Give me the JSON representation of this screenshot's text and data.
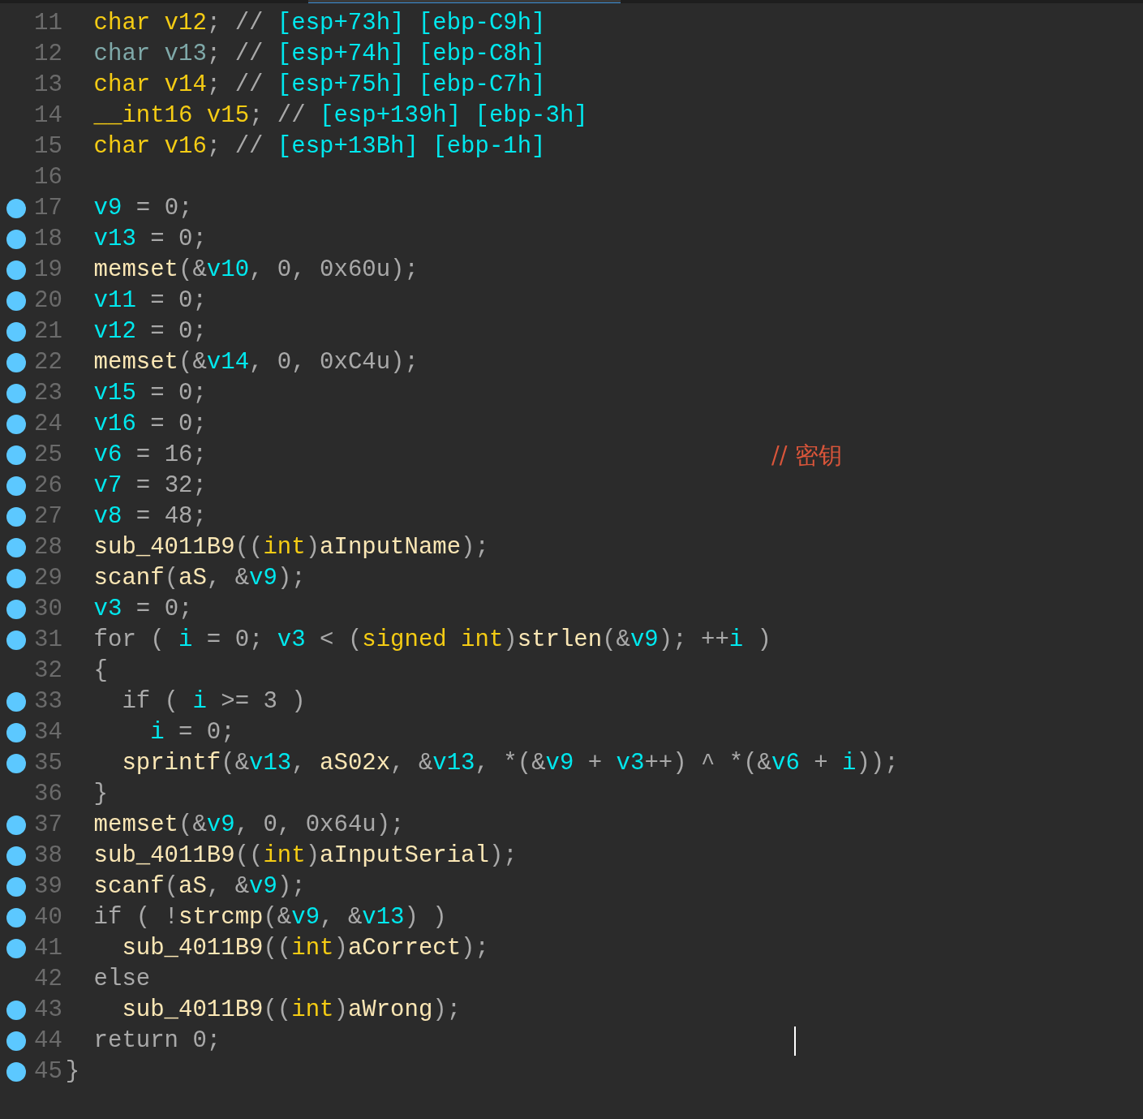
{
  "lines": [
    {
      "number": "11",
      "breakpoint": false,
      "tokens": [
        {
          "kind": "type",
          "text": "  char v12"
        },
        {
          "kind": "plain",
          "text": "; // "
        },
        {
          "kind": "address",
          "text": "[esp+73h] [ebp-C9h]"
        }
      ]
    },
    {
      "number": "12",
      "breakpoint": false,
      "tokens": [
        {
          "kind": "dim",
          "text": "  char v13"
        },
        {
          "kind": "plain",
          "text": "; // "
        },
        {
          "kind": "address",
          "text": "[esp+74h] [ebp-C8h]"
        }
      ]
    },
    {
      "number": "13",
      "breakpoint": false,
      "tokens": [
        {
          "kind": "type",
          "text": "  char v14"
        },
        {
          "kind": "plain",
          "text": "; // "
        },
        {
          "kind": "address",
          "text": "[esp+75h] [ebp-C7h]"
        }
      ]
    },
    {
      "number": "14",
      "breakpoint": false,
      "tokens": [
        {
          "kind": "type",
          "text": "  __int16 v15"
        },
        {
          "kind": "plain",
          "text": "; // "
        },
        {
          "kind": "address",
          "text": "[esp+139h] [ebp-3h]"
        }
      ]
    },
    {
      "number": "15",
      "breakpoint": false,
      "tokens": [
        {
          "kind": "type",
          "text": "  char v16"
        },
        {
          "kind": "plain",
          "text": "; // "
        },
        {
          "kind": "address",
          "text": "[esp+13Bh] [ebp-1h]"
        }
      ]
    },
    {
      "number": "16",
      "breakpoint": false
    },
    {
      "number": "17",
      "breakpoint": true,
      "tokens": [
        {
          "kind": "var",
          "text": "  v9"
        },
        {
          "kind": "plain",
          "text": " = 0;"
        }
      ]
    },
    {
      "number": "18",
      "breakpoint": true,
      "tokens": [
        {
          "kind": "var",
          "text": "  v13"
        },
        {
          "kind": "plain",
          "text": " = 0;"
        }
      ]
    },
    {
      "number": "19",
      "breakpoint": true,
      "tokens": [
        {
          "kind": "func",
          "text": "  memset"
        },
        {
          "kind": "plain",
          "text": "(&"
        },
        {
          "kind": "var",
          "text": "v10"
        },
        {
          "kind": "plain",
          "text": ", 0, 0x60u);"
        }
      ]
    },
    {
      "number": "20",
      "breakpoint": true,
      "tokens": [
        {
          "kind": "var",
          "text": "  v11"
        },
        {
          "kind": "plain",
          "text": " = 0;"
        }
      ]
    },
    {
      "number": "21",
      "breakpoint": true,
      "tokens": [
        {
          "kind": "var",
          "text": "  v12"
        },
        {
          "kind": "plain",
          "text": " = 0;"
        }
      ]
    },
    {
      "number": "22",
      "breakpoint": true,
      "tokens": [
        {
          "kind": "func",
          "text": "  memset"
        },
        {
          "kind": "plain",
          "text": "(&"
        },
        {
          "kind": "var",
          "text": "v14"
        },
        {
          "kind": "plain",
          "text": ", 0, 0xC4u);"
        }
      ]
    },
    {
      "number": "23",
      "breakpoint": true,
      "tokens": [
        {
          "kind": "var",
          "text": "  v15"
        },
        {
          "kind": "plain",
          "text": " = 0;"
        }
      ]
    },
    {
      "number": "24",
      "breakpoint": true,
      "tokens": [
        {
          "kind": "var",
          "text": "  v16"
        },
        {
          "kind": "plain",
          "text": " = 0;"
        }
      ]
    },
    {
      "number": "25",
      "breakpoint": true,
      "tokens": [
        {
          "kind": "var",
          "text": "  v6"
        },
        {
          "kind": "plain",
          "text": " = 16;"
        }
      ],
      "comment": "// 密钥"
    },
    {
      "number": "26",
      "breakpoint": true,
      "tokens": [
        {
          "kind": "var",
          "text": "  v7"
        },
        {
          "kind": "plain",
          "text": " = 32;"
        }
      ]
    },
    {
      "number": "27",
      "breakpoint": true,
      "tokens": [
        {
          "kind": "var",
          "text": "  v8"
        },
        {
          "kind": "plain",
          "text": " = 48;"
        }
      ]
    },
    {
      "number": "28",
      "breakpoint": true,
      "tokens": [
        {
          "kind": "func",
          "text": "  sub_4011B9"
        },
        {
          "kind": "plain",
          "text": "(("
        },
        {
          "kind": "type",
          "text": "int"
        },
        {
          "kind": "plain",
          "text": ")"
        },
        {
          "kind": "func",
          "text": "aInputName"
        },
        {
          "kind": "plain",
          "text": ");"
        }
      ]
    },
    {
      "number": "29",
      "breakpoint": true,
      "tokens": [
        {
          "kind": "func",
          "text": "  scanf"
        },
        {
          "kind": "plain",
          "text": "("
        },
        {
          "kind": "func",
          "text": "aS"
        },
        {
          "kind": "plain",
          "text": ", &"
        },
        {
          "kind": "var",
          "text": "v9"
        },
        {
          "kind": "plain",
          "text": ");"
        }
      ]
    },
    {
      "number": "30",
      "breakpoint": true,
      "tokens": [
        {
          "kind": "var",
          "text": "  v3"
        },
        {
          "kind": "plain",
          "text": " = 0;"
        }
      ]
    },
    {
      "number": "31",
      "breakpoint": true,
      "tokens": [
        {
          "kind": "plain",
          "text": "  for ( "
        },
        {
          "kind": "var",
          "text": "i"
        },
        {
          "kind": "plain",
          "text": " = 0; "
        },
        {
          "kind": "var",
          "text": "v3"
        },
        {
          "kind": "plain",
          "text": " < ("
        },
        {
          "kind": "type",
          "text": "signed int"
        },
        {
          "kind": "plain",
          "text": ")"
        },
        {
          "kind": "func",
          "text": "strlen"
        },
        {
          "kind": "plain",
          "text": "(&"
        },
        {
          "kind": "var",
          "text": "v9"
        },
        {
          "kind": "plain",
          "text": "); ++"
        },
        {
          "kind": "var",
          "text": "i"
        },
        {
          "kind": "plain",
          "text": " )"
        }
      ]
    },
    {
      "number": "32",
      "breakpoint": false,
      "tokens": [
        {
          "kind": "plain",
          "text": "  {"
        }
      ]
    },
    {
      "number": "33",
      "breakpoint": true,
      "tokens": [
        {
          "kind": "plain",
          "text": "    if ( "
        },
        {
          "kind": "var",
          "text": "i"
        },
        {
          "kind": "plain",
          "text": " >= 3 )"
        }
      ]
    },
    {
      "number": "34",
      "breakpoint": true,
      "tokens": [
        {
          "kind": "var",
          "text": "      i"
        },
        {
          "kind": "plain",
          "text": " = 0;"
        }
      ]
    },
    {
      "number": "35",
      "breakpoint": true,
      "tokens": [
        {
          "kind": "func",
          "text": "    sprintf"
        },
        {
          "kind": "plain",
          "text": "(&"
        },
        {
          "kind": "var",
          "text": "v13"
        },
        {
          "kind": "plain",
          "text": ", "
        },
        {
          "kind": "func",
          "text": "aS02x"
        },
        {
          "kind": "plain",
          "text": ", &"
        },
        {
          "kind": "var",
          "text": "v13"
        },
        {
          "kind": "plain",
          "text": ", *(&"
        },
        {
          "kind": "var",
          "text": "v9"
        },
        {
          "kind": "plain",
          "text": " + "
        },
        {
          "kind": "var",
          "text": "v3"
        },
        {
          "kind": "plain",
          "text": "++) ^ *(&"
        },
        {
          "kind": "var",
          "text": "v6"
        },
        {
          "kind": "plain",
          "text": " + "
        },
        {
          "kind": "var",
          "text": "i"
        },
        {
          "kind": "plain",
          "text": "));"
        }
      ]
    },
    {
      "number": "36",
      "breakpoint": false,
      "tokens": [
        {
          "kind": "plain",
          "text": "  }"
        }
      ]
    },
    {
      "number": "37",
      "breakpoint": true,
      "tokens": [
        {
          "kind": "func",
          "text": "  memset"
        },
        {
          "kind": "plain",
          "text": "(&"
        },
        {
          "kind": "var",
          "text": "v9"
        },
        {
          "kind": "plain",
          "text": ", 0, 0x64u);"
        }
      ]
    },
    {
      "number": "38",
      "breakpoint": true,
      "tokens": [
        {
          "kind": "func",
          "text": "  sub_4011B9"
        },
        {
          "kind": "plain",
          "text": "(("
        },
        {
          "kind": "type",
          "text": "int"
        },
        {
          "kind": "plain",
          "text": ")"
        },
        {
          "kind": "func",
          "text": "aInputSerial"
        },
        {
          "kind": "plain",
          "text": ");"
        }
      ]
    },
    {
      "number": "39",
      "breakpoint": true,
      "tokens": [
        {
          "kind": "func",
          "text": "  scanf"
        },
        {
          "kind": "plain",
          "text": "("
        },
        {
          "kind": "func",
          "text": "aS"
        },
        {
          "kind": "plain",
          "text": ", &"
        },
        {
          "kind": "var",
          "text": "v9"
        },
        {
          "kind": "plain",
          "text": ");"
        }
      ]
    },
    {
      "number": "40",
      "breakpoint": true,
      "tokens": [
        {
          "kind": "plain",
          "text": "  if ( !"
        },
        {
          "kind": "func",
          "text": "strcmp"
        },
        {
          "kind": "plain",
          "text": "(&"
        },
        {
          "kind": "var",
          "text": "v9"
        },
        {
          "kind": "plain",
          "text": ", &"
        },
        {
          "kind": "var",
          "text": "v13"
        },
        {
          "kind": "plain",
          "text": ") )"
        }
      ]
    },
    {
      "number": "41",
      "breakpoint": true,
      "tokens": [
        {
          "kind": "func",
          "text": "    sub_4011B9"
        },
        {
          "kind": "plain",
          "text": "(("
        },
        {
          "kind": "type",
          "text": "int"
        },
        {
          "kind": "plain",
          "text": ")"
        },
        {
          "kind": "func",
          "text": "aCorrect"
        },
        {
          "kind": "plain",
          "text": ");"
        }
      ]
    },
    {
      "number": "42",
      "breakpoint": false,
      "tokens": [
        {
          "kind": "plain",
          "text": "  else"
        }
      ]
    },
    {
      "number": "43",
      "breakpoint": true,
      "tokens": [
        {
          "kind": "func",
          "text": "    sub_4011B9"
        },
        {
          "kind": "plain",
          "text": "(("
        },
        {
          "kind": "type",
          "text": "int"
        },
        {
          "kind": "plain",
          "text": ")"
        },
        {
          "kind": "func",
          "text": "aWrong"
        },
        {
          "kind": "plain",
          "text": ");"
        }
      ]
    },
    {
      "number": "44",
      "breakpoint": true,
      "tokens": [
        {
          "kind": "plain",
          "text": "  return 0;"
        }
      ],
      "cursor": true
    },
    {
      "number": "45",
      "breakpoint": true,
      "tokens": [
        {
          "kind": "plain",
          "text": "}"
        }
      ]
    }
  ]
}
